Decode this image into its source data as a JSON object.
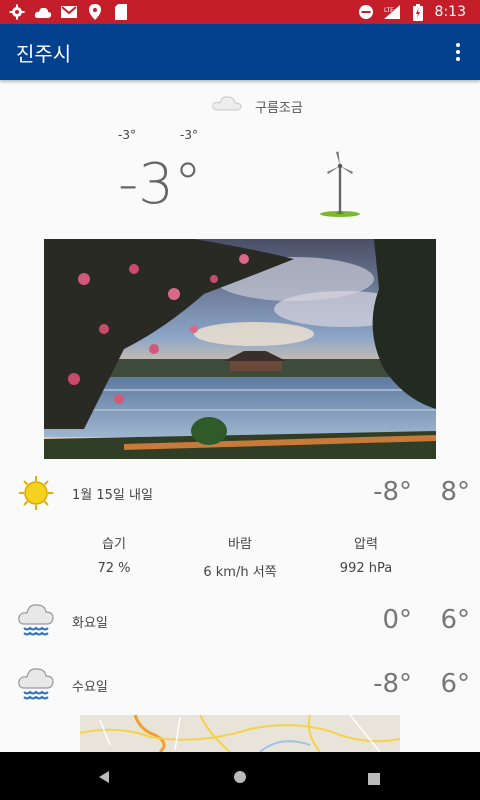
{
  "status_bar": {
    "time": "8:13",
    "icons_left": [
      "settings-icon",
      "cloud-icon",
      "gmail-icon",
      "location-icon",
      "sd-card-icon"
    ],
    "icons_right": [
      "do-not-disturb-icon",
      "lte-signal-icon",
      "battery-icon"
    ]
  },
  "app_bar": {
    "title": "진주시",
    "menu_icon": "more-vert-icon"
  },
  "current": {
    "condition": "구름조금",
    "low": "-3°",
    "high": "-3°",
    "temperature": "-3°"
  },
  "forecast": [
    {
      "label": "1월 15일 내일",
      "icon": "sun-icon",
      "low": "-8°",
      "high": "8°"
    },
    {
      "label": "화요일",
      "icon": "rain-cloud-icon",
      "low": "0°",
      "high": "6°"
    },
    {
      "label": "수요일",
      "icon": "rain-cloud-icon",
      "low": "-8°",
      "high": "6°"
    }
  ],
  "details": {
    "humidity_label": "습기",
    "humidity_value": "72 %",
    "wind_label": "바람",
    "wind_value": "6 km/h 서쪽",
    "pressure_label": "압력",
    "pressure_value": "992 hPa"
  },
  "colors": {
    "status_bar": "#c41e2a",
    "app_bar": "#03408e",
    "background": "#fafafa"
  }
}
